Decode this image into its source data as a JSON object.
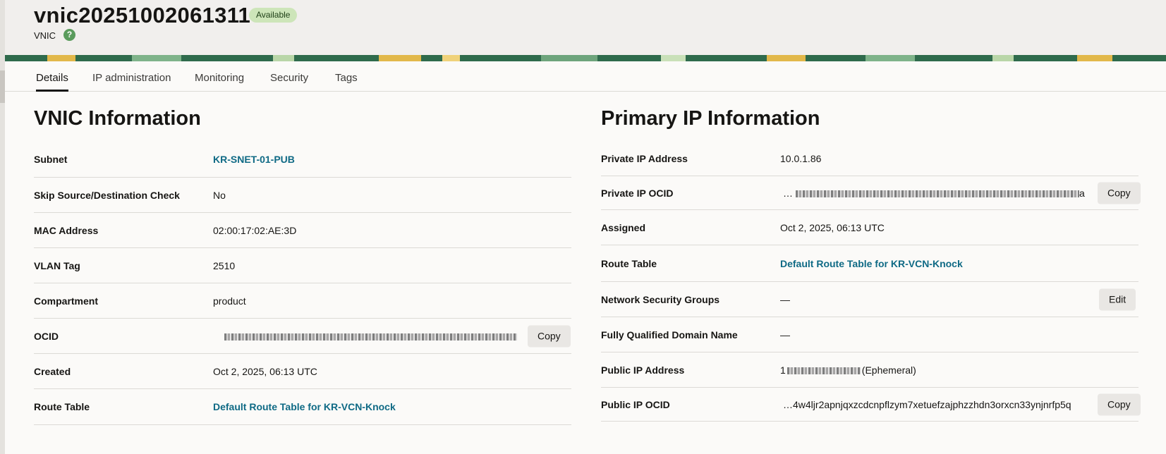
{
  "header": {
    "title": "vnic20251002061311",
    "status": "Available",
    "subtitle": "VNIC",
    "help_icon": "help-icon"
  },
  "tabs": [
    {
      "label": "Details",
      "active": true
    },
    {
      "label": "IP administration",
      "active": false
    },
    {
      "label": "Monitoring",
      "active": false
    },
    {
      "label": "Security",
      "active": false
    },
    {
      "label": "Tags",
      "active": false
    }
  ],
  "vnic_info": {
    "title": "VNIC Information",
    "rows": [
      {
        "label": "Subnet",
        "value": "KR-SNET-01-PUB"
      },
      {
        "label": "Skip Source/Destination Check",
        "value": "No"
      },
      {
        "label": "MAC Address",
        "value": "02:00:17:02:AE:3D"
      },
      {
        "label": "VLAN Tag",
        "value": "2510"
      },
      {
        "label": "Compartment",
        "value": "product"
      },
      {
        "label": "OCID",
        "value": "",
        "action": "Copy"
      },
      {
        "label": "Created",
        "value": "Oct 2, 2025, 06:13 UTC"
      },
      {
        "label": "Route Table",
        "value": "Default Route Table for KR-VCN-Knock"
      }
    ]
  },
  "primary_ip": {
    "title": "Primary IP Information",
    "rows": [
      {
        "label": "Private IP Address",
        "value": "10.0.1.86"
      },
      {
        "label": "Private IP OCID",
        "value_prefix": "…",
        "value_suffix": "a",
        "action": "Copy"
      },
      {
        "label": "Assigned",
        "value": "Oct 2, 2025, 06:13 UTC"
      },
      {
        "label": "Route Table",
        "value": "Default Route Table for KR-VCN-Knock"
      },
      {
        "label": "Network Security Groups",
        "value": "—",
        "action": "Edit"
      },
      {
        "label": "Fully Qualified Domain Name",
        "value": "—"
      },
      {
        "label": "Public IP Address",
        "value_prefix": "1",
        "value_suffix": "(Ephemeral)"
      },
      {
        "label": "Public IP OCID",
        "value": "…4w4ljr2apnjqxzcdcnpflzym7xetuefzajphzzhdn3orxcn33ynjnrfp5q",
        "action": "Copy"
      }
    ]
  },
  "colors": {
    "link": "#0f6a85",
    "badge_bg": "#cde5b9",
    "banner": "#2f6b4c"
  }
}
